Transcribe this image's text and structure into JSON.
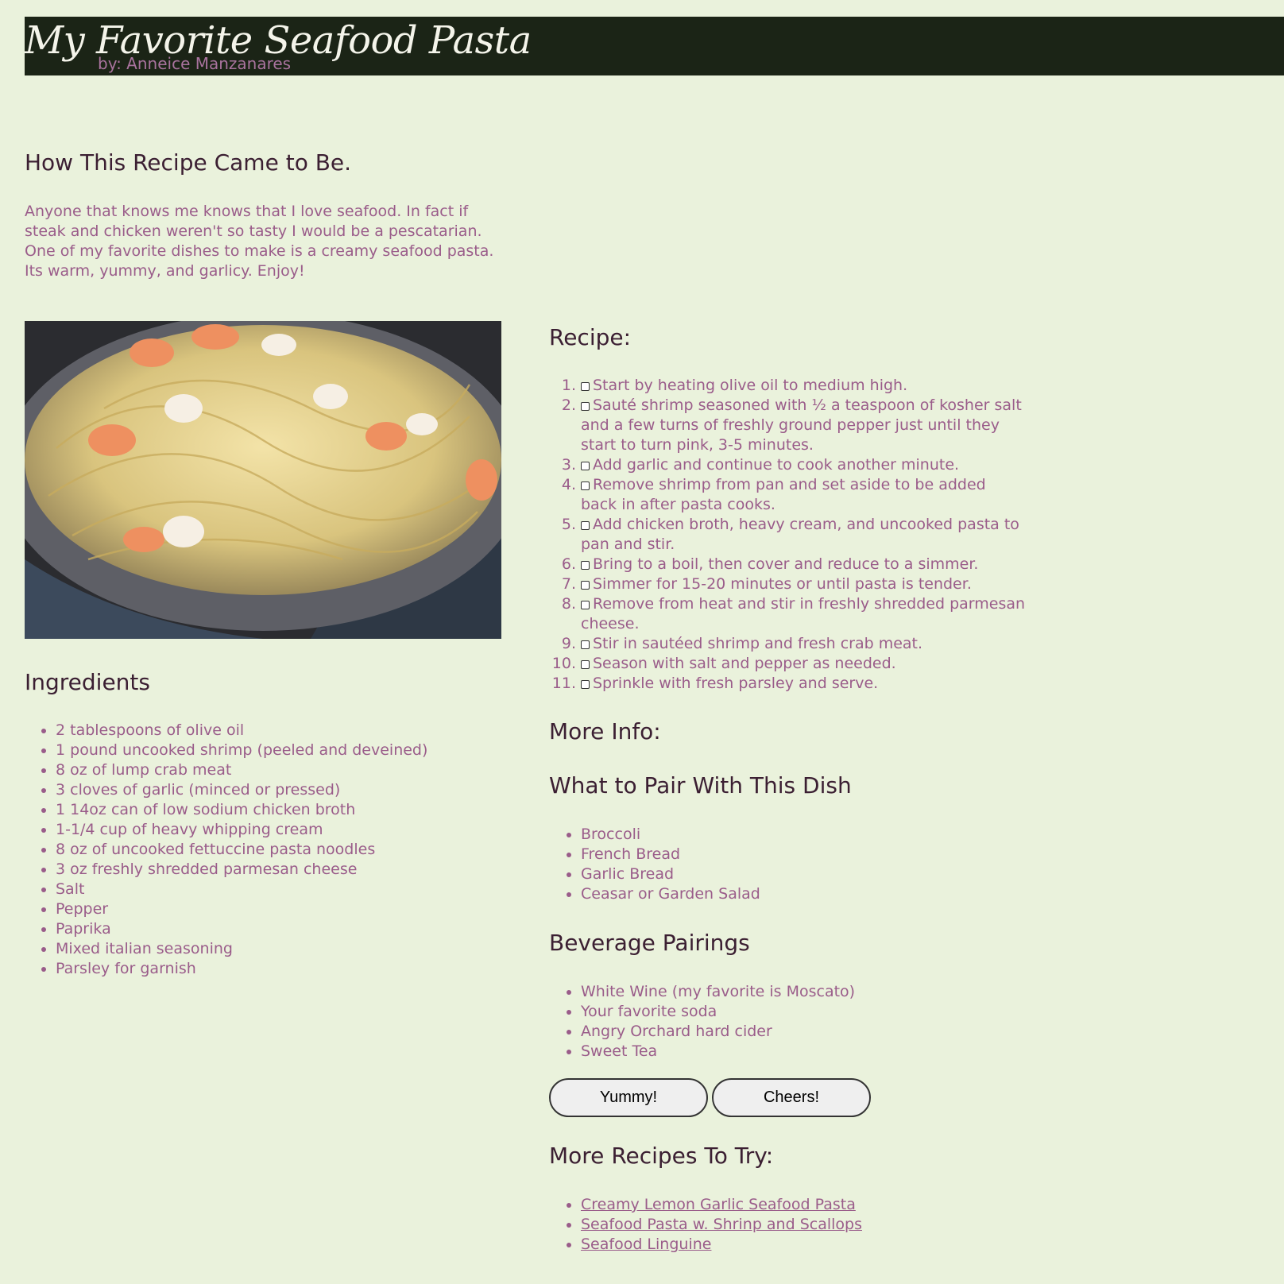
{
  "header": {
    "title": "My Favorite Seafood Pasta",
    "author": "by: Anneice Manzanares"
  },
  "story": {
    "heading": "How This Recipe Came to Be.",
    "text": "Anyone that knows me knows that I love seafood. In fact if steak and chicken weren't so tasty I would be a pescatarian. One of my favorite dishes to make is a creamy seafood pasta. Its warm, yummy, and garlicy. Enjoy!"
  },
  "photo": {
    "icon": "seafood-pasta-photo"
  },
  "ingredients": {
    "heading": "Ingredients",
    "items": [
      "2 tablespoons of olive oil",
      "1 pound uncooked shrimp (peeled and deveined)",
      "8 oz of lump crab meat",
      "3 cloves of garlic (minced or pressed)",
      "1 14oz can of low sodium chicken broth",
      "1-1/4 cup of heavy whipping cream",
      "8 oz of uncooked fettuccine pasta noodles",
      "3 oz freshly shredded parmesan cheese",
      "Salt",
      "Pepper",
      "Paprika",
      "Mixed italian seasoning",
      "Parsley for garnish"
    ]
  },
  "recipe": {
    "heading": "Recipe:",
    "steps": [
      "Start by heating olive oil to medium high.",
      "Sauté shrimp seasoned with ½ a teaspoon of kosher salt and a few turns of freshly ground pepper just until they start to turn pink, 3-5 minutes.",
      "Add garlic and continue to cook another minute.",
      "Remove shrimp from pan and set aside to be added back in after pasta cooks.",
      "Add chicken broth, heavy cream, and uncooked pasta to pan and stir.",
      "Bring to a boil, then cover and reduce to a simmer.",
      "Simmer for 15-20 minutes or until pasta is tender.",
      "Remove from heat and stir in freshly shredded parmesan cheese.",
      "Stir in sautéed shrimp and fresh crab meat.",
      "Season with salt and pepper as needed.",
      "Sprinkle with fresh parsley and serve."
    ]
  },
  "more_info": {
    "heading": "More Info:",
    "pair_heading": "What to Pair With This Dish",
    "pair_items": [
      "Broccoli",
      "French Bread",
      "Garlic Bread",
      "Ceasar or Garden Salad"
    ],
    "beverage_heading": "Beverage Pairings",
    "beverage_items": [
      "White Wine (my favorite is Moscato)",
      "Your favorite soda",
      "Angry Orchard hard cider",
      "Sweet Tea"
    ]
  },
  "buttons": {
    "yummy": "Yummy!",
    "cheers": "Cheers!"
  },
  "more_recipes": {
    "heading": "More Recipes To Try:",
    "links": [
      "Creamy Lemon Garlic Seafood Pasta",
      "Seafood Pasta w. Shrinp and Scallops",
      "Seafood Linguine"
    ]
  }
}
